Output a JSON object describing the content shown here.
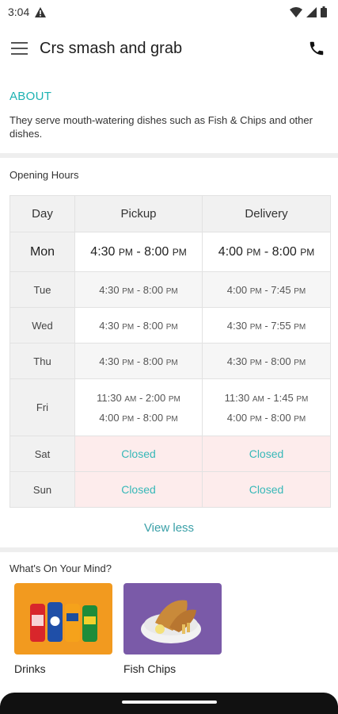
{
  "status_bar": {
    "time": "3:04",
    "battery_icon": "battery-icon",
    "wifi_icon": "wifi-icon",
    "signal_icon": "signal-icon",
    "alert_icon": "warning-icon"
  },
  "app_bar": {
    "title": "Crs smash and grab",
    "menu_icon": "hamburger-icon",
    "call_icon": "phone-icon"
  },
  "about": {
    "heading": "ABOUT",
    "text": "They serve mouth-watering dishes such as Fish & Chips and other dishes."
  },
  "hours": {
    "heading": "Opening Hours",
    "columns": [
      "Day",
      "Pickup",
      "Delivery"
    ],
    "rows": [
      {
        "day": "Mon",
        "pickup": [
          [
            "4:30",
            "PM",
            "8:00",
            "PM"
          ]
        ],
        "delivery": [
          [
            "4:00",
            "PM",
            "8:00",
            "PM"
          ]
        ]
      },
      {
        "day": "Tue",
        "pickup": [
          [
            "4:30",
            "PM",
            "8:00",
            "PM"
          ]
        ],
        "delivery": [
          [
            "4:00",
            "PM",
            "7:45",
            "PM"
          ]
        ]
      },
      {
        "day": "Wed",
        "pickup": [
          [
            "4:30",
            "PM",
            "8:00",
            "PM"
          ]
        ],
        "delivery": [
          [
            "4:30",
            "PM",
            "7:55",
            "PM"
          ]
        ]
      },
      {
        "day": "Thu",
        "pickup": [
          [
            "4:30",
            "PM",
            "8:00",
            "PM"
          ]
        ],
        "delivery": [
          [
            "4:30",
            "PM",
            "8:00",
            "PM"
          ]
        ]
      },
      {
        "day": "Fri",
        "pickup": [
          [
            "11:30",
            "AM",
            "2:00",
            "PM"
          ],
          [
            "4:00",
            "PM",
            "8:00",
            "PM"
          ]
        ],
        "delivery": [
          [
            "11:30",
            "AM",
            "1:45",
            "PM"
          ],
          [
            "4:00",
            "PM",
            "8:00",
            "PM"
          ]
        ]
      },
      {
        "day": "Sat",
        "pickup_closed": "Closed",
        "delivery_closed": "Closed"
      },
      {
        "day": "Sun",
        "pickup_closed": "Closed",
        "delivery_closed": "Closed"
      }
    ],
    "toggle_label": "View less"
  },
  "mind": {
    "heading": "What's On Your Mind?",
    "cards": [
      {
        "label": "Drinks",
        "color": "#f29a1f"
      },
      {
        "label": "Fish  Chips",
        "color": "#7a5aa8"
      }
    ]
  },
  "colors": {
    "accent": "#1cb2b2",
    "closed_bg": "#fdecec",
    "divider": "#eeeeee"
  }
}
